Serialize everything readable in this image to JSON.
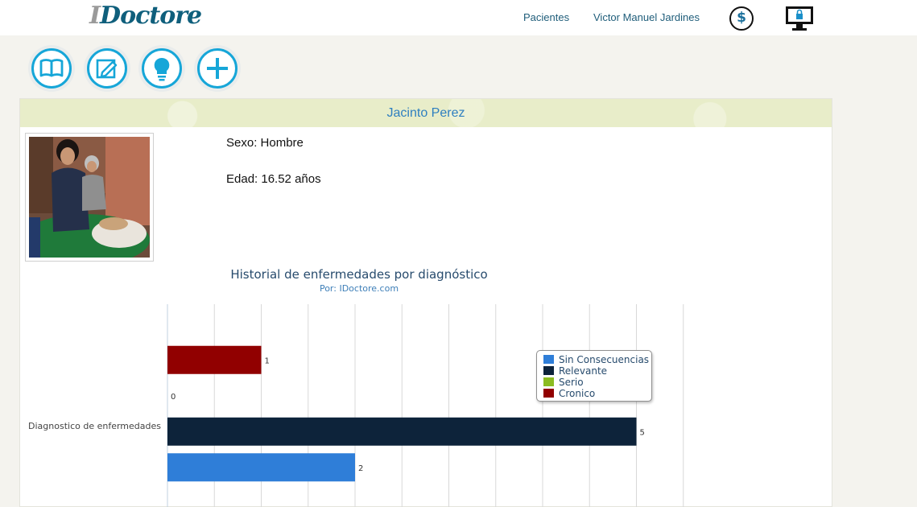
{
  "header": {
    "logo_first": "I",
    "logo_rest": "Doctore",
    "nav": {
      "pacientes": "Pacientes",
      "user": "Victor Manuel Jardines"
    },
    "icons": {
      "billing": "dollar-circle-icon",
      "lock_screen": "monitor-lock-icon"
    }
  },
  "actions": [
    {
      "icon": "book-icon"
    },
    {
      "icon": "edit-icon"
    },
    {
      "icon": "lightbulb-icon"
    },
    {
      "icon": "plus-icon"
    }
  ],
  "patient": {
    "name": "Jacinto Perez",
    "sexo": "Sexo: Hombre",
    "edad": "Edad: 16.52 años"
  },
  "colors": {
    "accent": "#16a6d8",
    "brand": "#0f5f7c",
    "header_band": "#e8edc9"
  },
  "chart_data": {
    "type": "bar",
    "orientation": "horizontal",
    "title": "Historial de enfermedades por diagnóstico",
    "subtitle": "Por: IDoctore.com",
    "categories": [
      "Diagnostico de enfermedades"
    ],
    "series": [
      {
        "name": "Sin Consecuencias",
        "values": [
          2
        ],
        "color": "#2f7ed8"
      },
      {
        "name": "Relevante",
        "values": [
          5
        ],
        "color": "#0d233a"
      },
      {
        "name": "Serio",
        "values": [
          0
        ],
        "color": "#8bbc21"
      },
      {
        "name": "Cronico",
        "values": [
          1
        ],
        "color": "#910000"
      }
    ],
    "xlim": [
      0,
      5.5
    ],
    "grid": true,
    "legend_position": "right"
  }
}
